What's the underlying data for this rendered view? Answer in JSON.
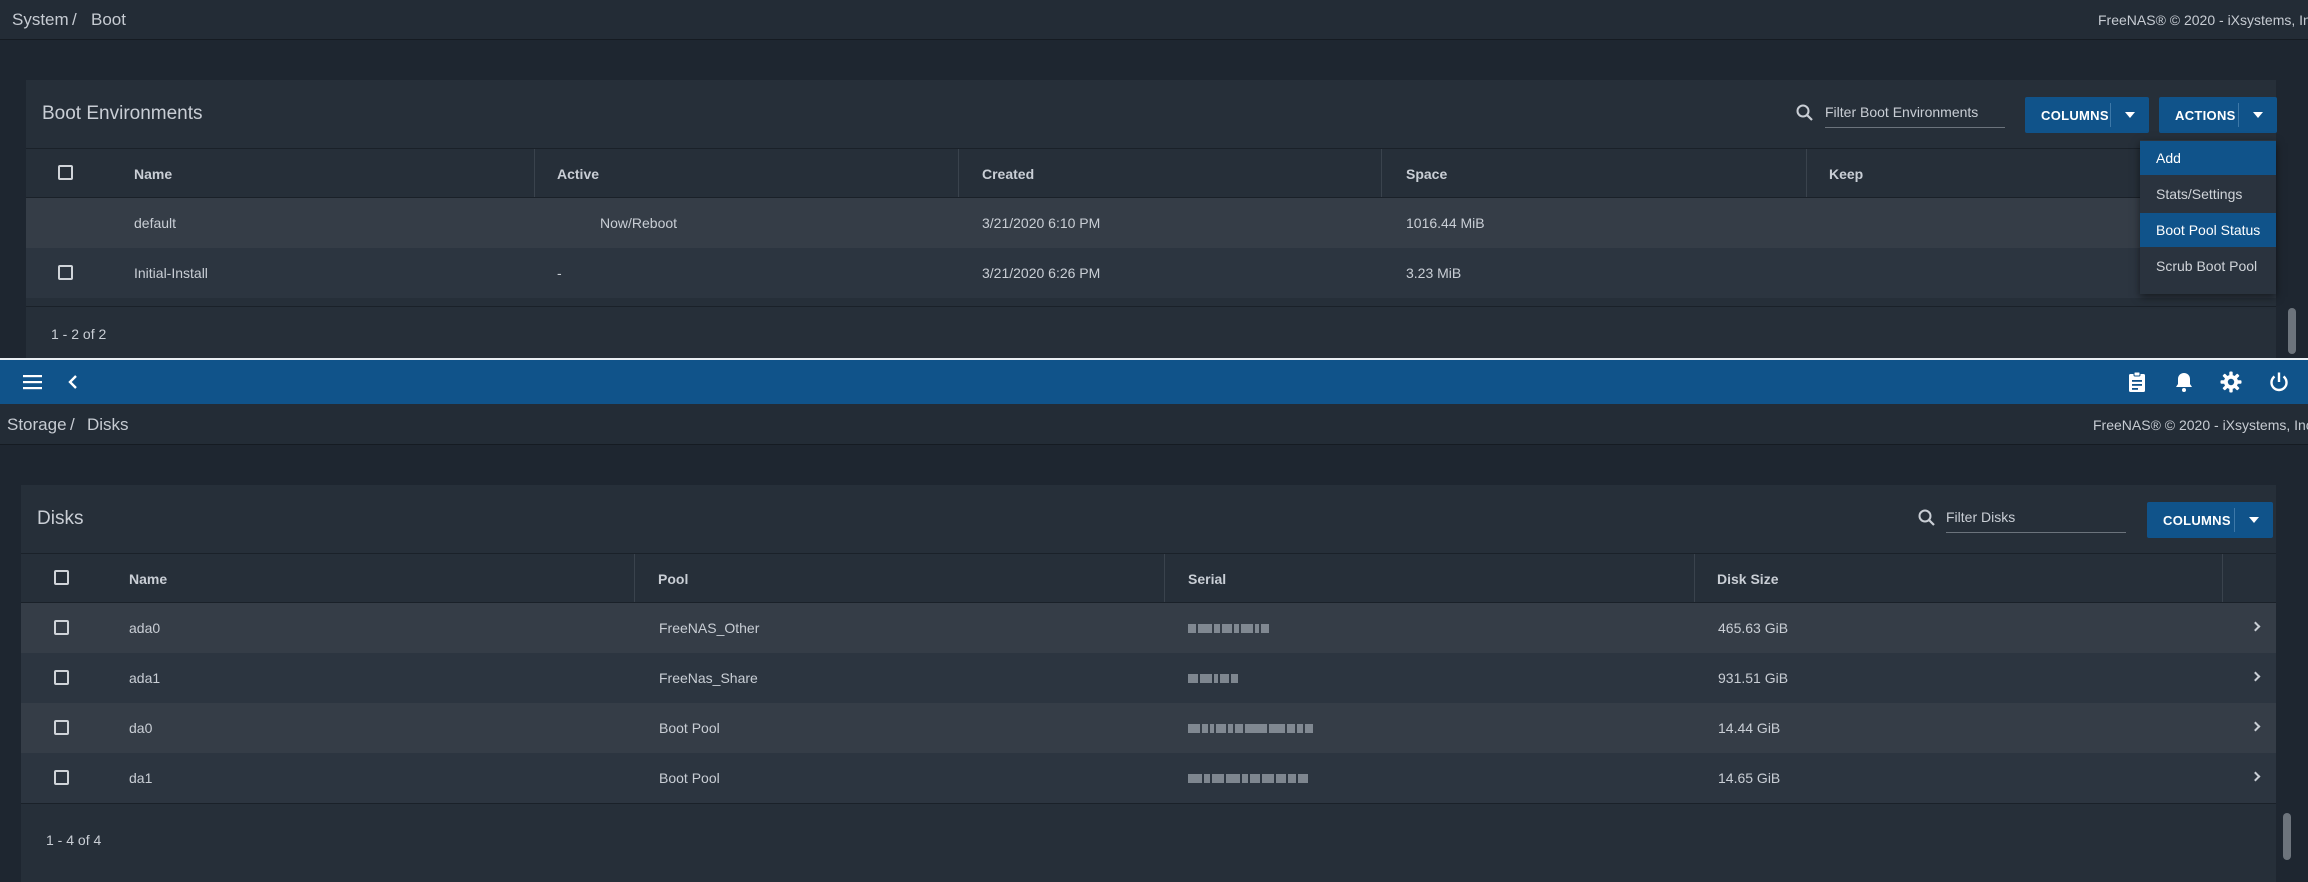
{
  "boot": {
    "breadcrumb": [
      "System",
      "Boot"
    ],
    "copyright": "FreeNAS® © 2020 - iXsystems, Inc",
    "title": "Boot Environments",
    "filter_placeholder": "Filter Boot Environments",
    "columns_button": "COLUMNS",
    "actions_button": "ACTIONS",
    "headers": [
      "Name",
      "Active",
      "Created",
      "Space",
      "Keep"
    ],
    "rows": [
      {
        "name": "default",
        "active": "Now/Reboot",
        "created": "3/21/2020 6:10 PM",
        "space": "1016.44 MiB"
      },
      {
        "name": "Initial-Install",
        "active": "-",
        "created": "3/21/2020 6:26 PM",
        "space": "3.23 MiB"
      }
    ],
    "footer": "1 - 2 of 2",
    "actions_menu": [
      "Add",
      "Stats/Settings",
      "Boot Pool Status",
      "Scrub Boot Pool"
    ]
  },
  "toolbar": {
    "icons": [
      "menu-icon",
      "back-icon",
      "task-manager-icon",
      "bell-icon",
      "gear-icon",
      "power-icon"
    ]
  },
  "disks": {
    "breadcrumb": [
      "Storage",
      "Disks"
    ],
    "copyright": "FreeNAS® © 2020 - iXsystems, Inc",
    "title": "Disks",
    "filter_placeholder": "Filter Disks",
    "columns_button": "COLUMNS",
    "headers": [
      "Name",
      "Pool",
      "Serial",
      "Disk Size"
    ],
    "rows": [
      {
        "name": "ada0",
        "pool": "FreeNAS_Other",
        "size": "465.63 GiB"
      },
      {
        "name": "ada1",
        "pool": "FreeNas_Share",
        "size": "931.51 GiB"
      },
      {
        "name": "da0",
        "pool": "Boot Pool",
        "size": "14.44 GiB"
      },
      {
        "name": "da1",
        "pool": "Boot Pool",
        "size": "14.65 GiB"
      }
    ],
    "footer": "1 - 4 of 4"
  },
  "colors": {
    "accent": "#10538a",
    "background": "#1e2630",
    "card": "#262f39",
    "row_alt": "#353d47"
  }
}
